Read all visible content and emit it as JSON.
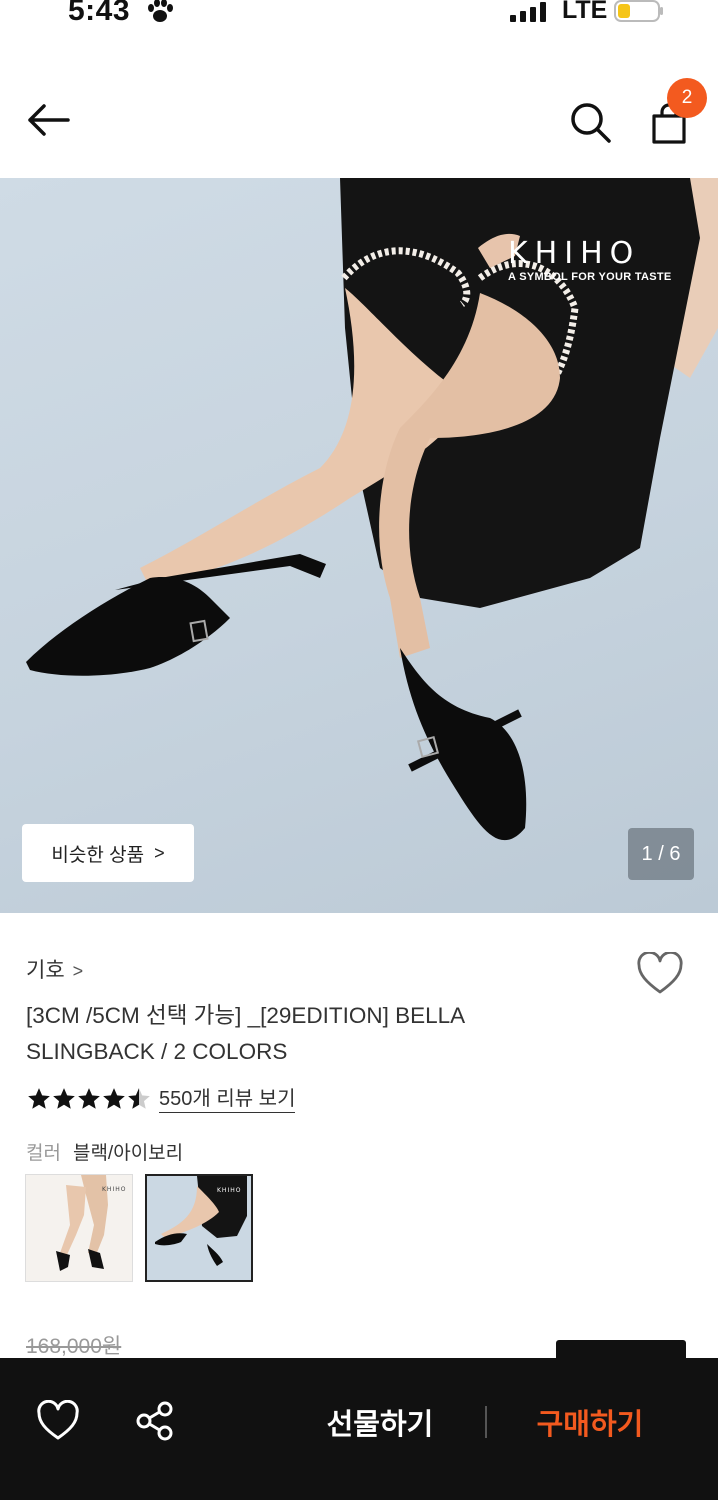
{
  "status_bar": {
    "time": "5:43",
    "network": "LTE",
    "icons": [
      "paw-icon",
      "signal-icon",
      "battery-icon"
    ]
  },
  "header": {
    "icons": [
      "back-arrow-icon",
      "search-icon",
      "shopping-bag-icon"
    ],
    "cart_count": "2"
  },
  "hero": {
    "brand_name": "KHIHO",
    "brand_tagline": "A SYMBOL FOR YOUR TASTE",
    "similar_products_label": "비슷한 상품",
    "page_indicator": "1 / 6"
  },
  "product": {
    "brand": "기호",
    "title": "[3CM /5CM 선택 가능] _[29EDITION] BELLA SLINGBACK / 2 COLORS",
    "rating": 4.5,
    "review_link": "550개 리뷰 보기",
    "color_label": "컬러",
    "color_value": "블랙/아이보리",
    "swatches": [
      "ivory-background",
      "blue-background"
    ],
    "selected_swatch": 2,
    "original_price": "168,000원"
  },
  "bottom_bar": {
    "icons": [
      "heart-icon",
      "share-icon"
    ],
    "gift_label": "선물하기",
    "buy_label": "구매하기"
  },
  "colors": {
    "accent": "#f35a1f",
    "bottom_bar": "#111111",
    "hero_background": "#c9d6e1"
  }
}
